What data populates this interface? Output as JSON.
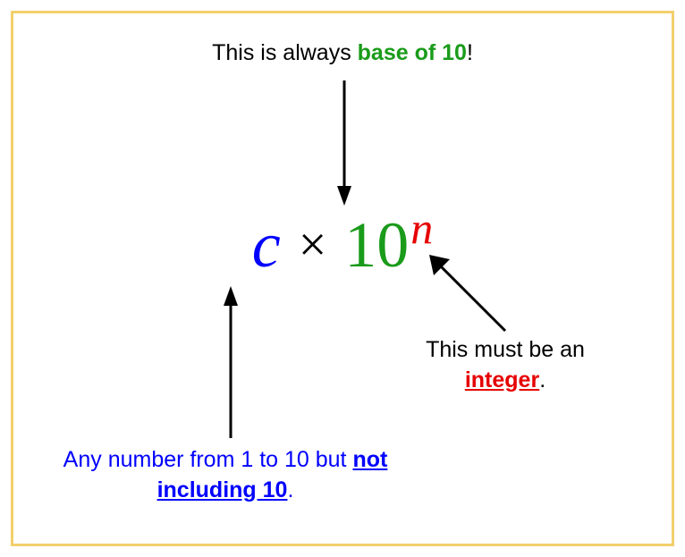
{
  "top": {
    "text1": "This is always ",
    "emph": "base of 10",
    "text2": "!"
  },
  "formula": {
    "c": "c",
    "times": "×",
    "ten": "10",
    "n": "n"
  },
  "right": {
    "text1": "This must be an ",
    "emph": "integer",
    "text2": "."
  },
  "bottom": {
    "text1": "Any number from 1 to 10 but ",
    "emph": "not including 10",
    "text2": "."
  }
}
